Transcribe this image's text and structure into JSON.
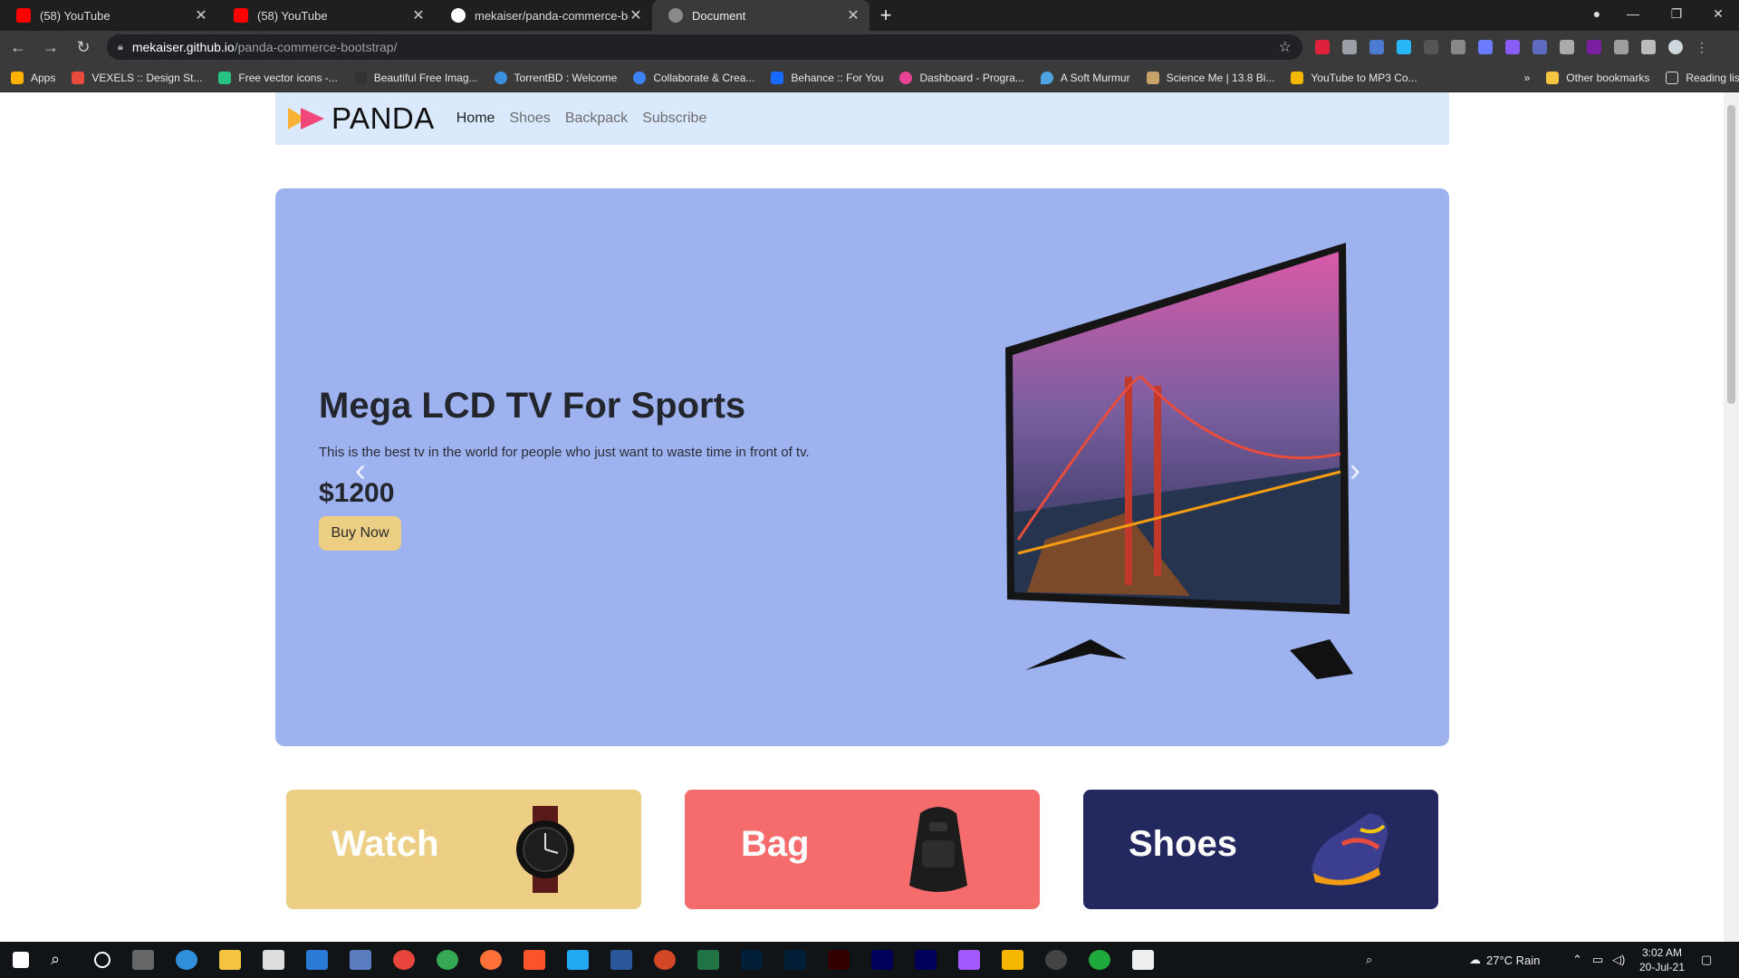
{
  "browser": {
    "tabs": [
      {
        "title": "(58) YouTube",
        "icon": "youtube-icon",
        "color": "#ff0000"
      },
      {
        "title": "(58) YouTube",
        "icon": "youtube-icon",
        "color": "#ff0000"
      },
      {
        "title": "mekaiser/panda-commerce-boo",
        "icon": "github-icon",
        "color": "#ffffff"
      },
      {
        "title": "Document",
        "icon": "globe-icon",
        "color": "#8a8a8a"
      }
    ],
    "new_tab": "+",
    "url_host": "mekaiser.github.io",
    "url_path": "/panda-commerce-bootstrap/",
    "bookmarks": [
      {
        "label": "Apps",
        "color": "#ffb300"
      },
      {
        "label": "VEXELS :: Design St...",
        "color": "#e84c3d"
      },
      {
        "label": "Free vector icons -...",
        "color": "#26c281"
      },
      {
        "label": "Beautiful Free Imag...",
        "color": "#333333"
      },
      {
        "label": "TorrentBD : Welcome",
        "color": "#3d8fe0"
      },
      {
        "label": "Collaborate & Crea...",
        "color": "#3b82f6"
      },
      {
        "label": "Behance :: For You",
        "color": "#1769ff"
      },
      {
        "label": "Dashboard - Progra...",
        "color": "#e84393"
      },
      {
        "label": "A Soft Murmur",
        "color": "#4fa3e0"
      },
      {
        "label": "Science Me | 13.8 Bi...",
        "color": "#c8a26b"
      },
      {
        "label": "YouTube to MP3 Co...",
        "color": "#f5b700"
      }
    ],
    "more_bookmarks": "»",
    "other_bookmarks": "Other bookmarks",
    "reading_list": "Reading list"
  },
  "site": {
    "brand": "PANDA",
    "nav": [
      "Home",
      "Shoes",
      "Backpack",
      "Subscribe"
    ],
    "hero": {
      "title": "Mega LCD TV For Sports",
      "description": "This is the best tv in the world for people who just want to waste time in front of tv.",
      "price": "$1200",
      "cta": "Buy Now"
    },
    "categories": [
      {
        "title": "Watch",
        "color": "#ecce84"
      },
      {
        "title": "Bag",
        "color": "#f56c6d"
      },
      {
        "title": "Shoes",
        "color": "#23295e"
      }
    ],
    "colors": {
      "hero_bg": "#9db2ee",
      "nav_bg": "#dbe9fd",
      "cta_bg": "#ecce84"
    }
  },
  "taskbar": {
    "weather": "27°C  Rain",
    "time": "3:02 AM",
    "date": "20-Jul-21"
  }
}
